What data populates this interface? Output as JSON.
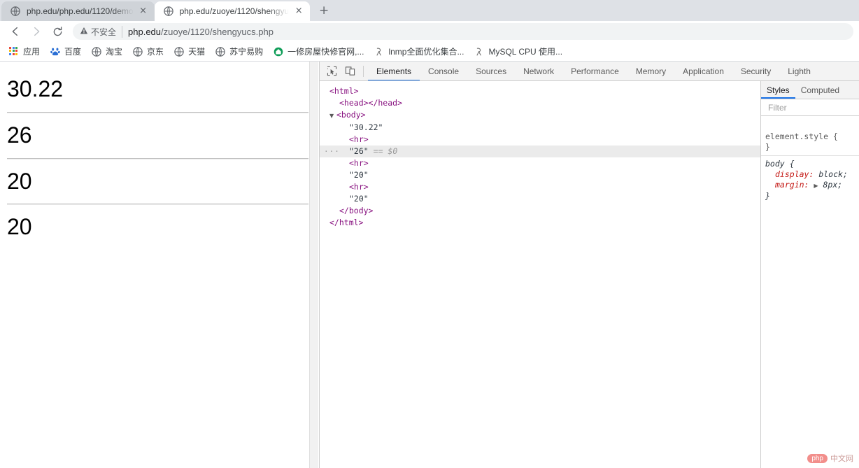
{
  "browser": {
    "tabs": [
      {
        "title": "php.edu/php.edu/1120/demo",
        "favicon": "globe-icon",
        "active": false,
        "close": "×"
      },
      {
        "title": "php.edu/zuoye/1120/shengyu",
        "favicon": "globe-icon",
        "active": true,
        "close": "×"
      }
    ],
    "new_tab_label": "+",
    "nav": {
      "back": "←",
      "forward": "→",
      "reload": "⟳"
    },
    "omnibox": {
      "security_icon": "warning-triangle-icon",
      "security_label": "不安全",
      "url_host": "php.edu",
      "url_path": "/zuoye/1120/shengyucs.php"
    },
    "bookmarks": [
      {
        "label": "应用",
        "icon": "apps-grid-icon"
      },
      {
        "label": "百度",
        "icon": "baidu-icon"
      },
      {
        "label": "淘宝",
        "icon": "globe-icon"
      },
      {
        "label": "京东",
        "icon": "globe-icon"
      },
      {
        "label": "天猫",
        "icon": "globe-icon"
      },
      {
        "label": "苏宁易购",
        "icon": "globe-icon"
      },
      {
        "label": "一修房屋快修官网,...",
        "icon": "home-green-icon"
      },
      {
        "label": "lnmp全面优化集合...",
        "icon": "bookmark-gray-icon"
      },
      {
        "label": "MySQL CPU 使用...",
        "icon": "bookmark-gray-icon"
      }
    ]
  },
  "page": {
    "lines": [
      "30.22",
      "26",
      "20",
      "20"
    ]
  },
  "devtools": {
    "toolbar_icons": [
      {
        "name": "inspect-element-icon"
      },
      {
        "name": "device-toolbar-icon"
      }
    ],
    "tabs": [
      {
        "label": "Elements",
        "active": true
      },
      {
        "label": "Console",
        "active": false
      },
      {
        "label": "Sources",
        "active": false
      },
      {
        "label": "Network",
        "active": false
      },
      {
        "label": "Performance",
        "active": false
      },
      {
        "label": "Memory",
        "active": false
      },
      {
        "label": "Application",
        "active": false
      },
      {
        "label": "Security",
        "active": false
      },
      {
        "label": "Lighth",
        "active": false
      }
    ],
    "dom": {
      "rows": [
        {
          "indent": 0,
          "twisty": "",
          "markup": "html-open",
          "selected": false
        },
        {
          "indent": 1,
          "twisty": "",
          "markup": "head-pair",
          "selected": false
        },
        {
          "indent": 0,
          "twisty": "▼",
          "markup": "body-open",
          "selected": false
        },
        {
          "indent": 2,
          "twisty": "",
          "markup": "text-3022",
          "selected": false
        },
        {
          "indent": 2,
          "twisty": "",
          "markup": "hr-1",
          "selected": false
        },
        {
          "indent": 2,
          "twisty": "",
          "markup": "text-26",
          "selected": true
        },
        {
          "indent": 2,
          "twisty": "",
          "markup": "hr-2",
          "selected": false
        },
        {
          "indent": 2,
          "twisty": "",
          "markup": "text-20a",
          "selected": false
        },
        {
          "indent": 2,
          "twisty": "",
          "markup": "hr-3",
          "selected": false
        },
        {
          "indent": 2,
          "twisty": "",
          "markup": "text-20b",
          "selected": false
        },
        {
          "indent": 1,
          "twisty": "",
          "markup": "body-close",
          "selected": false
        },
        {
          "indent": 0,
          "twisty": "",
          "markup": "html-close",
          "selected": false
        }
      ],
      "text": {
        "html_open": "<html>",
        "html_close": "</html>",
        "head_pair": "<head></head>",
        "body_open": "<body>",
        "body_close": "</body>",
        "hr": "<hr>",
        "t_3022": "\"30.22\"",
        "t_26": "\"26\"",
        "t_20a": "\"20\"",
        "t_20b": "\"20\"",
        "selection_marker": "== $0",
        "row_menu_dots": "···"
      }
    },
    "styles": {
      "tabs": [
        {
          "label": "Styles",
          "active": true
        },
        {
          "label": "Computed",
          "active": false
        }
      ],
      "filter_placeholder": "Filter",
      "rules": [
        {
          "selector": "element.style {",
          "close": "}",
          "declarations": []
        },
        {
          "selector": "body {",
          "close": "}",
          "declarations": [
            {
              "prop": "display:",
              "value": "block;",
              "expandable": false
            },
            {
              "prop": "margin:",
              "value": "8px;",
              "expandable": true,
              "arrow": "▶"
            }
          ]
        }
      ]
    }
  },
  "watermark": {
    "badge": "php",
    "text": "中文网"
  },
  "colors": {
    "accent": "#1a73e8",
    "tab_active_bg": "#ffffff",
    "tab_inactive_bg": "#cfd3d8",
    "tabstrip_bg": "#dee1e6",
    "devtools_toolbar_bg": "#f3f3f3",
    "dom_tag": "#881280",
    "dom_text": "#303942",
    "css_prop": "#c41a16",
    "selected_row_bg": "#ebebeb"
  }
}
